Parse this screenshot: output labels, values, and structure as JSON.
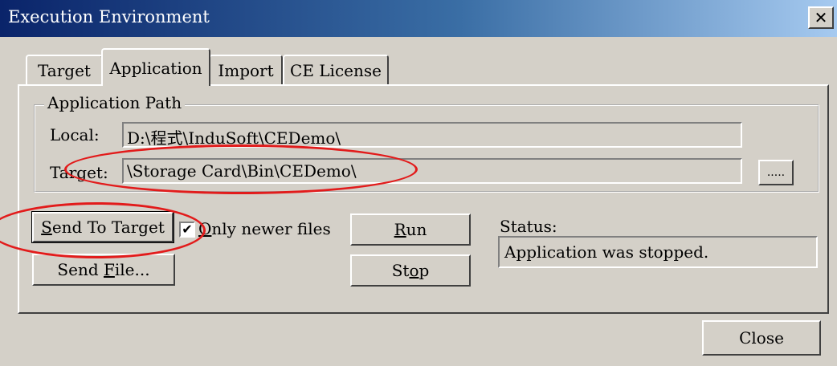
{
  "window": {
    "title": "Execution Environment",
    "close_glyph": "✕"
  },
  "tabs": [
    {
      "label": "Target",
      "active": false
    },
    {
      "label": "Application",
      "active": true
    },
    {
      "label": "Import",
      "active": false
    },
    {
      "label": "CE License",
      "active": false
    }
  ],
  "application_path": {
    "group_label": "Application Path",
    "local_label": "Local:",
    "local_value": "D:\\程式\\InduSoft\\CEDemo\\",
    "target_label": "Target:",
    "target_value": "\\Storage Card\\Bin\\CEDemo\\",
    "browse_label": "....."
  },
  "actions": {
    "send_to_target": {
      "pre": "",
      "mnemonic": "S",
      "post": "end To Target"
    },
    "send_file": {
      "pre": "Send ",
      "mnemonic": "F",
      "post": "ile..."
    },
    "only_newer": {
      "checked": true,
      "check_glyph": "✔",
      "pre": "",
      "mnemonic": "O",
      "post": "nly newer files"
    },
    "run": {
      "pre": "",
      "mnemonic": "R",
      "post": "un"
    },
    "stop": {
      "pre": "St",
      "mnemonic": "o",
      "post": "p"
    }
  },
  "status": {
    "label": "Status:",
    "value": "Application was stopped."
  },
  "footer": {
    "close_label": "Close"
  },
  "annotations": {
    "color": "#e21b1b",
    "items": [
      "target-path-highlight",
      "send-to-target-highlight"
    ]
  }
}
